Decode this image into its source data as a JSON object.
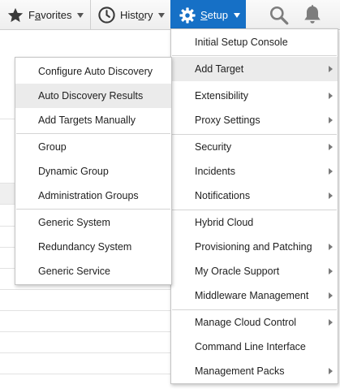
{
  "toolbar": {
    "favorites": {
      "prefix": "F",
      "underlined": "a",
      "suffix": "vorites",
      "icon": "star-icon"
    },
    "history": {
      "prefix": "Hist",
      "underlined": "o",
      "suffix": "ry",
      "icon": "clock-icon"
    },
    "setup": {
      "prefix": "",
      "underlined": "S",
      "suffix": "etup",
      "icon": "gear-icon"
    },
    "search_icon": "search-icon",
    "notifications_icon": "bell-icon"
  },
  "setup_menu": {
    "items": [
      {
        "label": "Initial Setup Console",
        "submenu": false
      },
      {
        "label": "Add Target",
        "submenu": true,
        "highlighted": true
      },
      {
        "label": "Extensibility",
        "submenu": true
      },
      {
        "label": "Proxy Settings",
        "submenu": true
      },
      {
        "label": "Security",
        "submenu": true
      },
      {
        "label": "Incidents",
        "submenu": true
      },
      {
        "label": "Notifications",
        "submenu": true
      },
      {
        "label": "Hybrid Cloud",
        "submenu": false
      },
      {
        "label": "Provisioning and Patching",
        "submenu": true
      },
      {
        "label": "My Oracle Support",
        "submenu": true
      },
      {
        "label": "Middleware Management",
        "submenu": true
      },
      {
        "label": "Manage Cloud Control",
        "submenu": true
      },
      {
        "label": "Command Line Interface",
        "submenu": false
      },
      {
        "label": "Management Packs",
        "submenu": true
      }
    ]
  },
  "add_target_menu": {
    "items": [
      {
        "label": "Configure Auto Discovery"
      },
      {
        "label": "Auto Discovery Results",
        "highlighted": true
      },
      {
        "label": "Add Targets Manually"
      },
      {
        "label": "Group"
      },
      {
        "label": "Dynamic Group"
      },
      {
        "label": "Administration Groups"
      },
      {
        "label": "Generic System"
      },
      {
        "label": "Redundancy System"
      },
      {
        "label": "Generic Service"
      }
    ]
  },
  "colors": {
    "setup_active_bg": "#1670c6",
    "menu_highlight": "#ebebeb",
    "toolbar_bg": "#f3f3f3"
  }
}
